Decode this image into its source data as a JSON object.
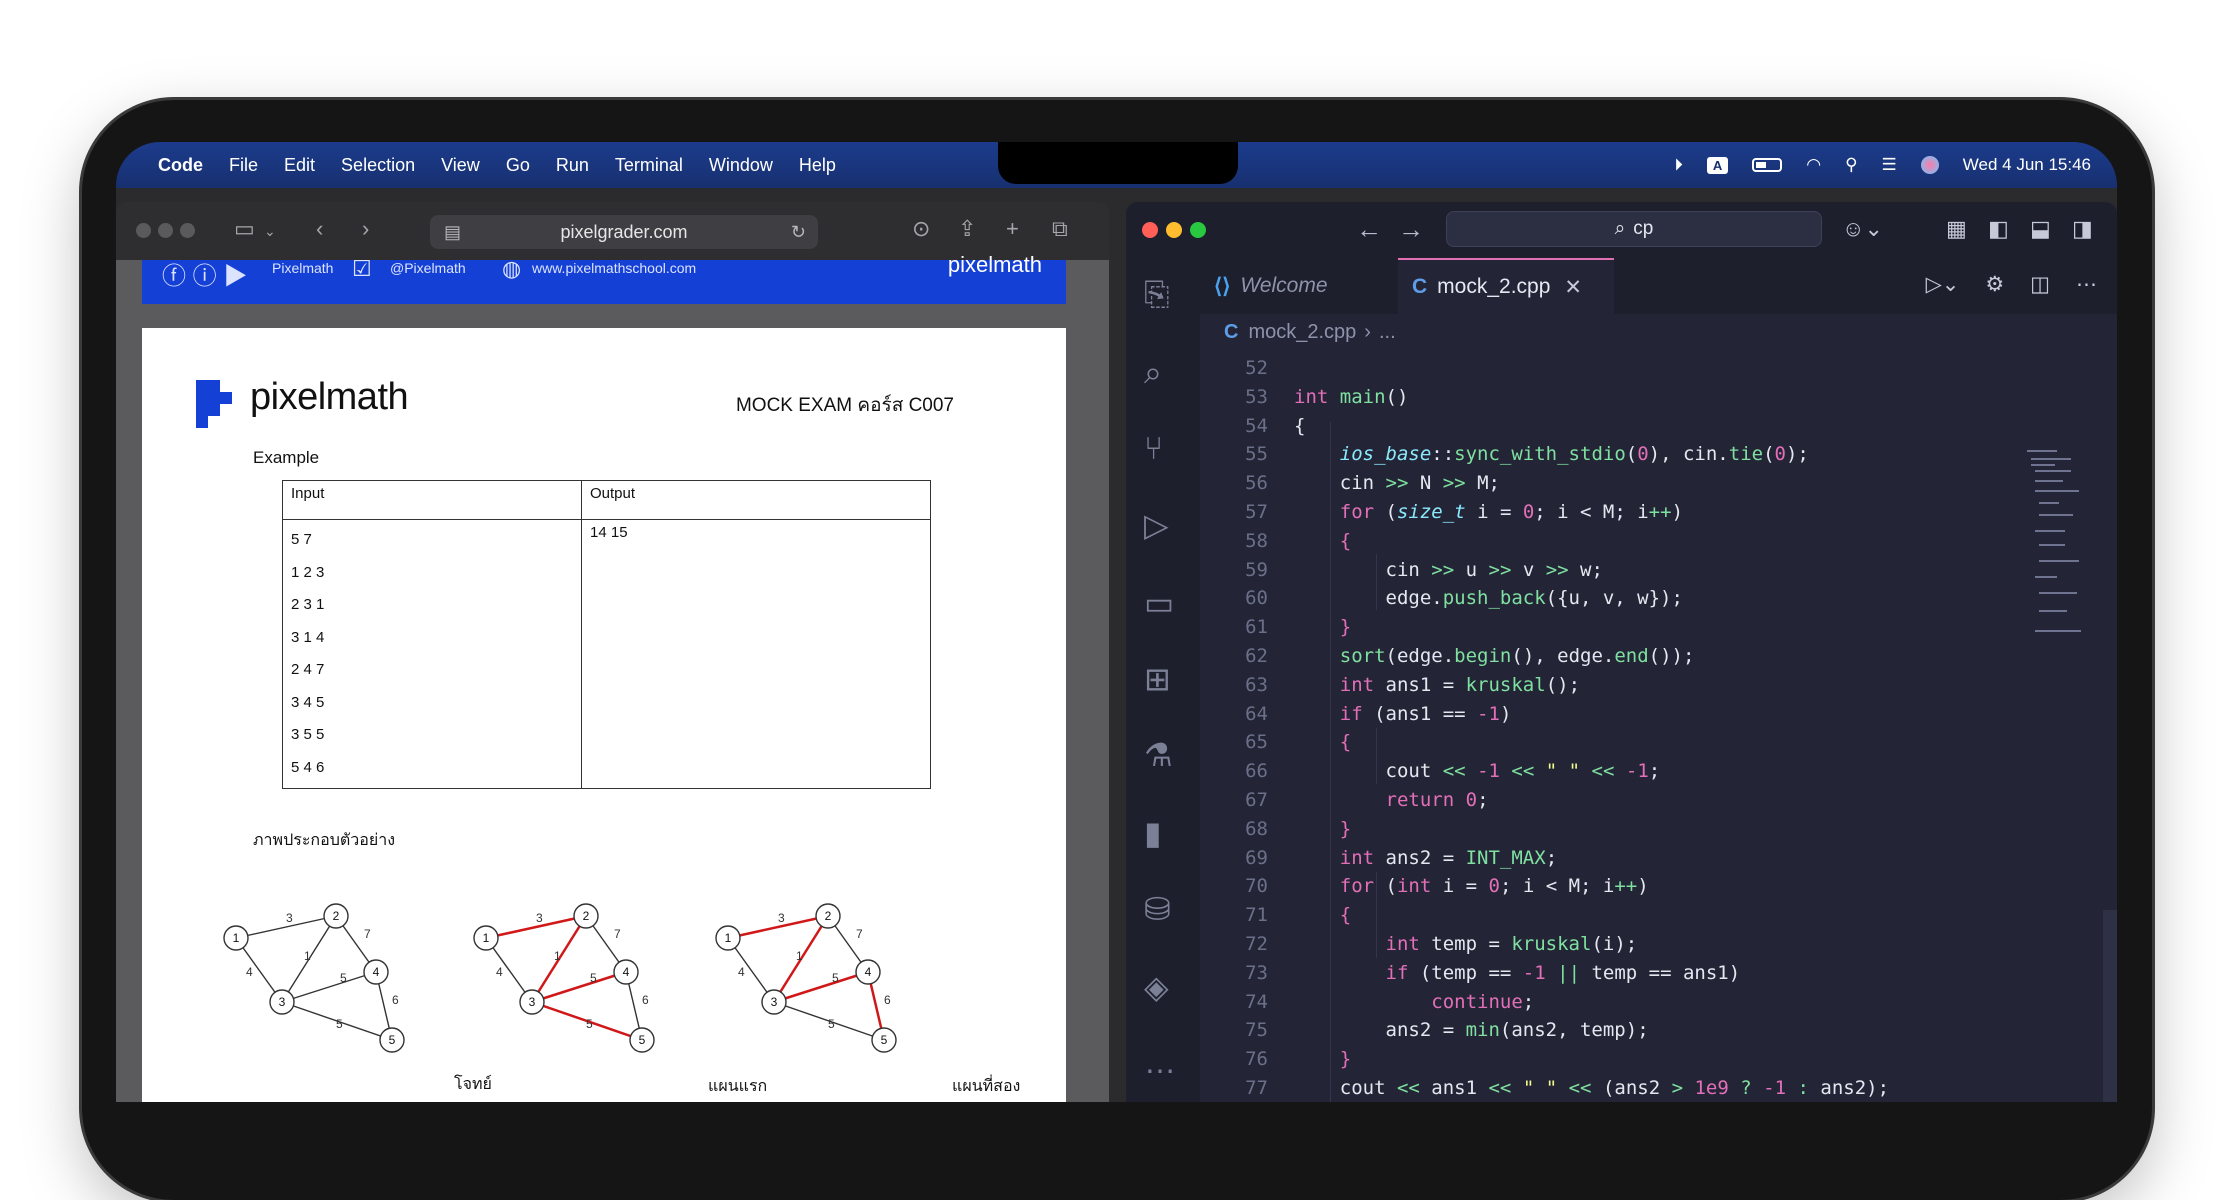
{
  "menubar": {
    "app": "Code",
    "items": [
      "File",
      "Edit",
      "Selection",
      "View",
      "Go",
      "Run",
      "Terminal",
      "Window",
      "Help"
    ],
    "input_badge": "A",
    "datetime": "Wed 4 Jun  15:46"
  },
  "safari": {
    "url": "pixelgrader.com",
    "banner": {
      "social1": "Pixelmath",
      "social2": "@Pixelmath",
      "website": "www.pixelmathschool.com",
      "brand": "pixelmath"
    },
    "doc": {
      "logo": "pixelmath",
      "exam_title": "MOCK EXAM คอร์ส C007",
      "example_label": "Example",
      "table": {
        "headers": [
          "Input",
          "Output"
        ],
        "input_lines": [
          "5 7",
          "1 2 3",
          "2 3 1",
          "3 1 4",
          "2 4 7",
          "3 4 5",
          "3 5 5",
          "5 4 6"
        ],
        "output": "14 15"
      },
      "diagram_label": "ภาพประกอบตัวอย่าง",
      "captions": [
        "โจทย์",
        "แผนแรก",
        "แผนที่สอง"
      ],
      "graph": {
        "nodes": [
          "1",
          "2",
          "3",
          "4",
          "5"
        ],
        "edge_weights": [
          "3",
          "4",
          "1",
          "7",
          "5",
          "6",
          "5"
        ]
      }
    }
  },
  "vscode": {
    "search": "cp",
    "tabs": [
      {
        "label": "Welcome"
      },
      {
        "label": "mock_2.cpp"
      }
    ],
    "breadcrumb": {
      "file": "mock_2.cpp",
      "more": "..."
    },
    "lines": [
      {
        "n": "52",
        "html": ""
      },
      {
        "n": "53",
        "html": "<span class='kw'>int</span> <span class='fn'>main</span>()"
      },
      {
        "n": "54",
        "html": "{"
      },
      {
        "n": "55",
        "html": "    <span class='ty'>ios_base</span>::<span class='fn'>sync_with_stdio</span>(<span class='num'>0</span>), cin.<span class='fn'>tie</span>(<span class='num'>0</span>);"
      },
      {
        "n": "56",
        "html": "    cin <span class='op'>&gt;&gt;</span> N <span class='op'>&gt;&gt;</span> M;"
      },
      {
        "n": "57",
        "html": "    <span class='kw'>for</span> (<span class='ty'>size_t</span> i = <span class='num'>0</span>; i &lt; M; i<span class='op'>++</span>)"
      },
      {
        "n": "58",
        "html": "    <span class='kw'>{</span>"
      },
      {
        "n": "59",
        "html": "        cin <span class='op'>&gt;&gt;</span> u <span class='op'>&gt;&gt;</span> v <span class='op'>&gt;&gt;</span> w;"
      },
      {
        "n": "60",
        "html": "        edge.<span class='fn'>push_back</span>({u, v, w});"
      },
      {
        "n": "61",
        "html": "    <span class='kw'>}</span>"
      },
      {
        "n": "62",
        "html": "    <span class='fn'>sort</span>(edge.<span class='fn'>begin</span>(), edge.<span class='fn'>end</span>());"
      },
      {
        "n": "63",
        "html": "    <span class='kw'>int</span> ans1 = <span class='fn'>kruskal</span>();"
      },
      {
        "n": "64",
        "html": "    <span class='kw'>if</span> (ans1 == <span class='num'>-1</span>)"
      },
      {
        "n": "65",
        "html": "    <span class='kw'>{</span>"
      },
      {
        "n": "66",
        "html": "        cout <span class='op'>&lt;&lt;</span> <span class='num'>-1</span> <span class='op'>&lt;&lt;</span> <span class='str'>\" \"</span> <span class='op'>&lt;&lt;</span> <span class='num'>-1</span>;"
      },
      {
        "n": "67",
        "html": "        <span class='kw'>return</span> <span class='num'>0</span>;"
      },
      {
        "n": "68",
        "html": "    <span class='kw'>}</span>"
      },
      {
        "n": "69",
        "html": "    <span class='kw'>int</span> ans2 = <span class='ty' style='font-style:normal;color:#7fe0a0'>INT_MAX</span>;"
      },
      {
        "n": "70",
        "html": "    <span class='kw'>for</span> (<span class='kw'>int</span> i = <span class='num'>0</span>; i &lt; M; i<span class='op'>++</span>)"
      },
      {
        "n": "71",
        "html": "    <span class='kw'>{</span>"
      },
      {
        "n": "72",
        "html": "        <span class='kw'>int</span> temp = <span class='fn'>kruskal</span>(i);"
      },
      {
        "n": "73",
        "html": "        <span class='kw'>if</span> (temp == <span class='num'>-1</span> <span class='op'>||</span> temp == ans1)"
      },
      {
        "n": "74",
        "html": "            <span class='kw'>continue</span>;"
      },
      {
        "n": "75",
        "html": "        ans2 = <span class='fn'>min</span>(ans2, temp);"
      },
      {
        "n": "76",
        "html": "    <span class='kw'>}</span>"
      },
      {
        "n": "77",
        "html": "    cout <span class='op'>&lt;&lt;</span> ans1 <span class='op'>&lt;&lt;</span> <span class='str'>\" \"</span> <span class='op'>&lt;&lt;</span> (ans2 <span class='op'>&gt;</span> <span class='num'>1e9</span> <span class='op'>?</span> <span class='num'>-1</span> <span class='op'>:</span> ans2);"
      }
    ]
  }
}
